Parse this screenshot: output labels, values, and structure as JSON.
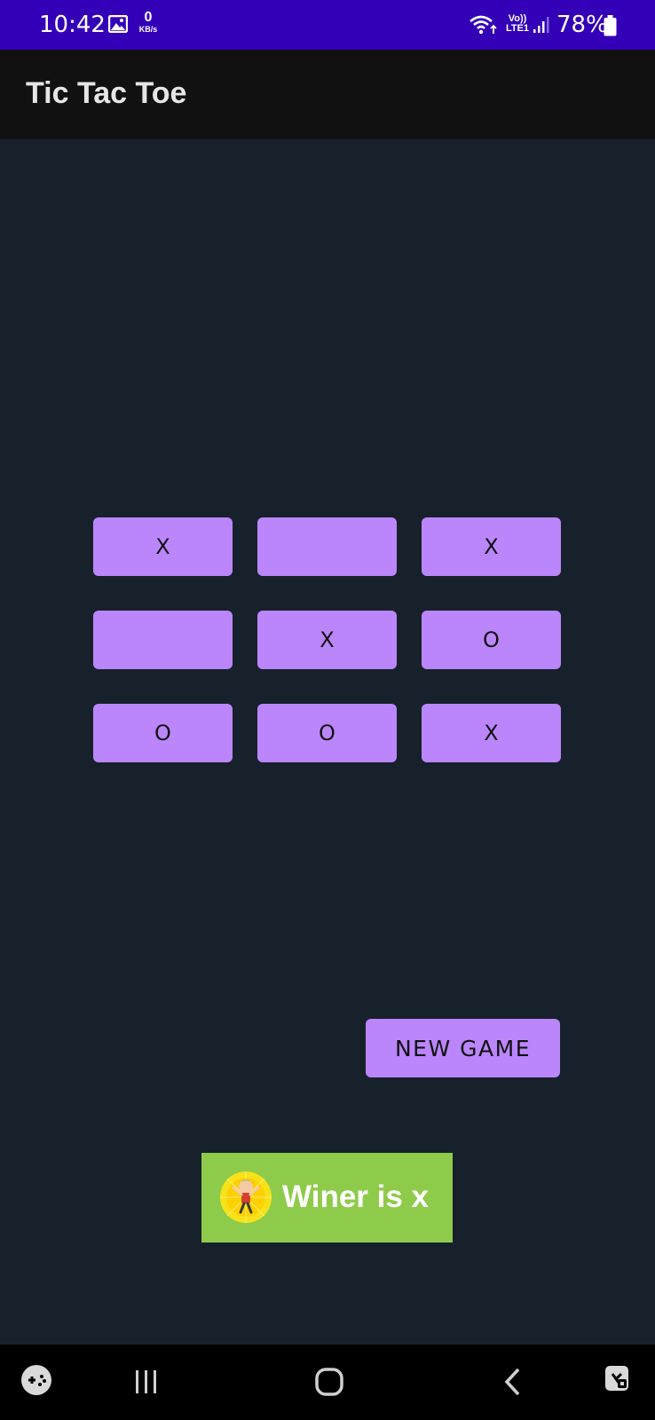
{
  "status_bar": {
    "time": "10:42",
    "net_speed_value": "0",
    "net_speed_unit": "KB/s",
    "lte_top": "Vo))",
    "lte_bottom": "LTE1",
    "battery_percent": "78%",
    "icons": [
      "gallery-icon",
      "wifi-icon",
      "signal-icon",
      "battery-icon"
    ]
  },
  "app_bar": {
    "title": "Tic Tac Toe"
  },
  "board": {
    "cells": [
      "X",
      "",
      "X",
      "",
      "X",
      "O",
      "O",
      "O",
      "X"
    ]
  },
  "new_game_label": "NEW GAME",
  "winner_banner": {
    "text": "Winer is x",
    "icon": "mascot-icon",
    "background": "#8fcb4a"
  },
  "nav_bar": {
    "icons": [
      "game-launcher-icon",
      "recent-apps-icon",
      "home-icon",
      "back-icon",
      "accessibility-icon"
    ]
  },
  "colors": {
    "status_bar": "#3300b8",
    "app_bar": "#111111",
    "background": "#17212c",
    "button": "#bb86fc"
  }
}
